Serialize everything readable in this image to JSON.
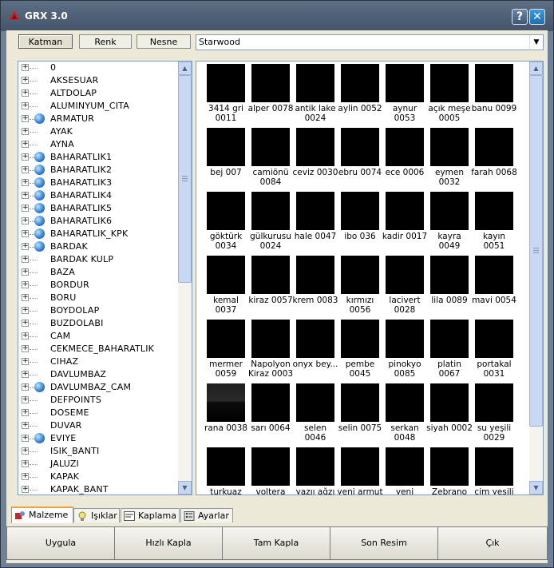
{
  "window": {
    "title": "GRX 3.0",
    "help_label": "?",
    "close_label": "✕"
  },
  "top_tabs": [
    {
      "label": "Katman",
      "active": true
    },
    {
      "label": "Renk",
      "active": false
    },
    {
      "label": "Nesne",
      "active": false
    }
  ],
  "combo": {
    "value": "Starwood",
    "arrow": "▼"
  },
  "tree": {
    "items": [
      {
        "label": "0",
        "globe": false
      },
      {
        "label": "AKSESUAR",
        "globe": false
      },
      {
        "label": "ALTDOLAP",
        "globe": false
      },
      {
        "label": "ALUMINYUM_CITA",
        "globe": false
      },
      {
        "label": "ARMATUR",
        "globe": true
      },
      {
        "label": "AYAK",
        "globe": false
      },
      {
        "label": "AYNA",
        "globe": false
      },
      {
        "label": "BAHARATLIK1",
        "globe": true
      },
      {
        "label": "BAHARATLIK2",
        "globe": true
      },
      {
        "label": "BAHARATLIK3",
        "globe": true
      },
      {
        "label": "BAHARATLIK4",
        "globe": true
      },
      {
        "label": "BAHARATLIK5",
        "globe": true
      },
      {
        "label": "BAHARATLIK6",
        "globe": true
      },
      {
        "label": "BAHARATLIK_KPK",
        "globe": true
      },
      {
        "label": "BARDAK",
        "globe": true
      },
      {
        "label": "BARDAK KULP",
        "globe": false
      },
      {
        "label": "BAZA",
        "globe": false
      },
      {
        "label": "BORDUR",
        "globe": false
      },
      {
        "label": "BORU",
        "globe": false
      },
      {
        "label": "BOYDOLAP",
        "globe": false
      },
      {
        "label": "BUZDOLABI",
        "globe": false
      },
      {
        "label": "CAM",
        "globe": false
      },
      {
        "label": "CEKMECE_BAHARATLIK",
        "globe": false
      },
      {
        "label": "CIHAZ",
        "globe": false
      },
      {
        "label": "DAVLUMBAZ",
        "globe": false
      },
      {
        "label": "DAVLUMBAZ_CAM",
        "globe": true
      },
      {
        "label": "DEFPOINTS",
        "globe": false
      },
      {
        "label": "DOSEME",
        "globe": false
      },
      {
        "label": "DUVAR",
        "globe": false
      },
      {
        "label": "EVIYE",
        "globe": true
      },
      {
        "label": "ISIK_BANTI",
        "globe": false
      },
      {
        "label": "JALUZI",
        "globe": false
      },
      {
        "label": "KAPAK",
        "globe": false
      },
      {
        "label": "KAPAK_BANT",
        "globe": false
      }
    ]
  },
  "materials": [
    {
      "label": "3414 gri 0011"
    },
    {
      "label": "alper 0078"
    },
    {
      "label": "antik lake 0024"
    },
    {
      "label": "aylin 0052"
    },
    {
      "label": "aynur 0053"
    },
    {
      "label": "açık meşe 0005"
    },
    {
      "label": "banu 0099"
    },
    {
      "label": "bej 007"
    },
    {
      "label": "camiönü 0084"
    },
    {
      "label": "ceviz 0030"
    },
    {
      "label": "ebru 0074"
    },
    {
      "label": "ece 0006"
    },
    {
      "label": "eymen 0032"
    },
    {
      "label": "farah 0068"
    },
    {
      "label": "göktürk 0034"
    },
    {
      "label": "gülkurusu 0024"
    },
    {
      "label": "hale 0047"
    },
    {
      "label": "ibo 036"
    },
    {
      "label": "kadir 0017"
    },
    {
      "label": "kayra 0049"
    },
    {
      "label": "kayın 0051"
    },
    {
      "label": "kemal 0037"
    },
    {
      "label": "kiraz 0057"
    },
    {
      "label": "krem 0083"
    },
    {
      "label": "kırmızı 0056"
    },
    {
      "label": "lacivert 0028"
    },
    {
      "label": "lila 0089"
    },
    {
      "label": "mavi 0054"
    },
    {
      "label": "mermer 0059"
    },
    {
      "label": "Napolyon Kiraz 0003"
    },
    {
      "label": "onyx bey..."
    },
    {
      "label": "pembe 0045"
    },
    {
      "label": "pinokyo 0085"
    },
    {
      "label": "platin 0067"
    },
    {
      "label": "portakal 0031"
    },
    {
      "label": "rana 0038",
      "gray": true
    },
    {
      "label": "sarı 0064"
    },
    {
      "label": "selen 0046"
    },
    {
      "label": "selin 0075"
    },
    {
      "label": "serkan 0048"
    },
    {
      "label": "siyah 0002"
    },
    {
      "label": "su yeşili 0029"
    },
    {
      "label": "turkuaz"
    },
    {
      "label": "voltera"
    },
    {
      "label": "yazıı ağzı"
    },
    {
      "label": "yeni armut"
    },
    {
      "label": "yeni yenge"
    },
    {
      "label": "Zebrano"
    },
    {
      "label": "çim yeşili"
    }
  ],
  "bottom_tabs": [
    {
      "label": "Malzeme",
      "icon": "material-icon",
      "active": true
    },
    {
      "label": "Işıklar",
      "icon": "lightbulb-icon",
      "active": false
    },
    {
      "label": "Kaplama",
      "icon": "mapping-icon",
      "active": false
    },
    {
      "label": "Ayarlar",
      "icon": "settings-icon",
      "active": false
    }
  ],
  "actions": [
    {
      "label": "Uygula"
    },
    {
      "label": "Hızlı Kapla"
    },
    {
      "label": "Tam Kapla"
    },
    {
      "label": "Son Resim"
    },
    {
      "label": "Çık"
    }
  ]
}
